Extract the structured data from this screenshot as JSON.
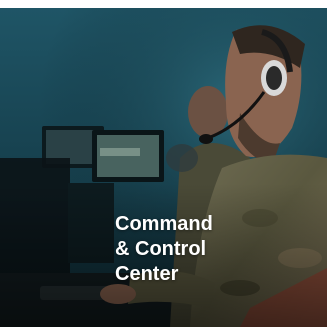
{
  "card": {
    "title_lines": [
      "Command",
      "& Control",
      "Center"
    ]
  },
  "colors": {
    "background_teal": "#1f5566",
    "camo": "#6b6a4f",
    "title_text": "#ffffff"
  },
  "image": {
    "subject": "operators with headsets at monitors",
    "icon": "photo"
  }
}
